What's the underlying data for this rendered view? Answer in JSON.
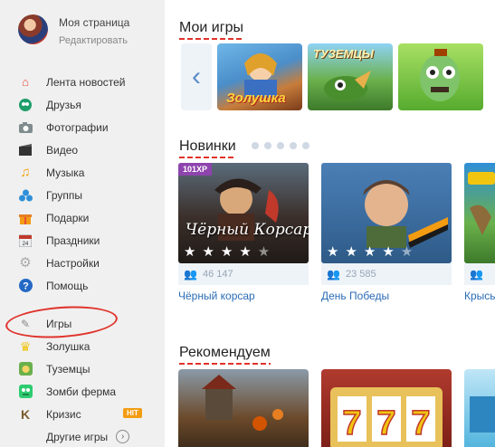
{
  "profile": {
    "name": "Моя страница",
    "edit": "Редактировать"
  },
  "nav": [
    {
      "label": "Лента новостей",
      "icon": "home-icon"
    },
    {
      "label": "Друзья",
      "icon": "friends-icon"
    },
    {
      "label": "Фотографии",
      "icon": "camera-icon"
    },
    {
      "label": "Видео",
      "icon": "video-icon"
    },
    {
      "label": "Музыка",
      "icon": "music-icon"
    },
    {
      "label": "Группы",
      "icon": "groups-icon"
    },
    {
      "label": "Подарки",
      "icon": "gift-icon"
    },
    {
      "label": "Праздники",
      "icon": "calendar-icon"
    },
    {
      "label": "Настройки",
      "icon": "gear-icon"
    },
    {
      "label": "Помощь",
      "icon": "help-icon"
    }
  ],
  "games_nav": {
    "games_label": "Игры",
    "items": [
      {
        "label": "Золушка",
        "icon": "crown-icon"
      },
      {
        "label": "Туземцы",
        "icon": "tuzemtsy-icon"
      },
      {
        "label": "Зомби ферма",
        "icon": "zombie-icon"
      },
      {
        "label": "Кризис",
        "icon": "krizis-icon",
        "badge": "HIT"
      }
    ],
    "more_label": "Другие игры"
  },
  "my_games": {
    "title": "Мои игры",
    "tiles": [
      {
        "name": "Золушка",
        "overlay": "Золушка"
      },
      {
        "name": "Туземцы",
        "overlay": "ТУЗЕМЦЫ"
      },
      {
        "name": "Зомби ферма",
        "overlay": ""
      }
    ]
  },
  "new_games": {
    "title": "Новинки",
    "cards": [
      {
        "title": "Чёрный корсар",
        "players": "46 147",
        "tag": "101XP",
        "overlay": "Чёрный Корсар",
        "rating": 4
      },
      {
        "title": "День Победы",
        "players": "23 585",
        "rating": 4
      },
      {
        "title": "Крысь",
        "players": "",
        "rating": 0
      }
    ]
  },
  "recommend": {
    "title": "Рекомендуем"
  },
  "colors": {
    "accent": "#e0332b",
    "link": "#2b6cb5",
    "badge": "#f39c12"
  }
}
